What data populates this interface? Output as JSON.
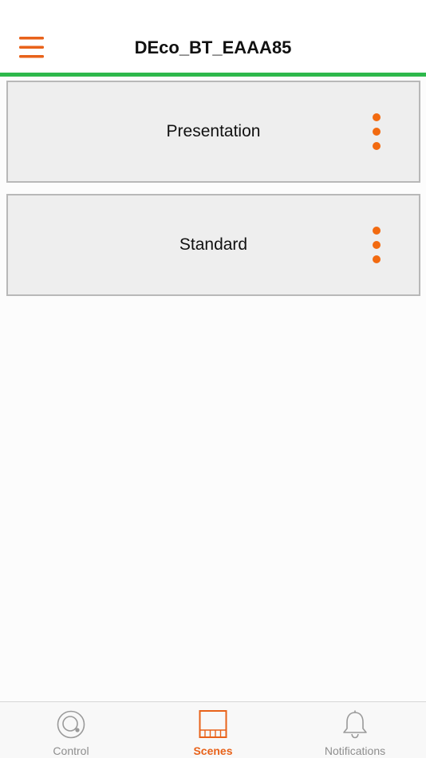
{
  "header": {
    "title": "DEco_BT_EAAA85",
    "menu_icon": "hamburger-menu-icon"
  },
  "scenes": [
    {
      "name": "Presentation",
      "more_icon": "more-vertical-icon"
    },
    {
      "name": "Standard",
      "more_icon": "more-vertical-icon"
    }
  ],
  "tabs": [
    {
      "label": "Control",
      "icon": "control-dial-icon",
      "active": false
    },
    {
      "label": "Scenes",
      "icon": "scenes-grid-icon",
      "active": true
    },
    {
      "label": "Notifications",
      "icon": "bell-icon",
      "active": false
    }
  ],
  "colors": {
    "accent": "#e8621a",
    "header_rule": "#2db84b",
    "card_background": "#eeeeee",
    "card_border": "#b8b8b8",
    "inactive_tab": "#8e8e8e"
  }
}
